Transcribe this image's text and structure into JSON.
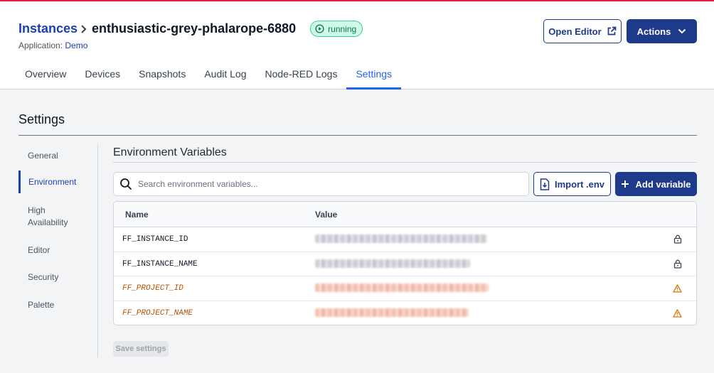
{
  "breadcrumb": {
    "parent": "Instances",
    "current": "enthusiastic-grey-phalarope-6880"
  },
  "status": "running",
  "application": {
    "label": "Application:",
    "name": "Demo"
  },
  "header_buttons": {
    "open_editor": "Open Editor",
    "actions": "Actions"
  },
  "tabs": [
    {
      "label": "Overview"
    },
    {
      "label": "Devices"
    },
    {
      "label": "Snapshots"
    },
    {
      "label": "Audit Log"
    },
    {
      "label": "Node-RED Logs"
    },
    {
      "label": "Settings",
      "active": true
    }
  ],
  "settings": {
    "title": "Settings",
    "sidebar": [
      {
        "label": "General"
      },
      {
        "label": "Environment",
        "active": true
      },
      {
        "label": "High Availability"
      },
      {
        "label": "Editor"
      },
      {
        "label": "Security"
      },
      {
        "label": "Palette"
      }
    ]
  },
  "env": {
    "section_title": "Environment Variables",
    "search_placeholder": "Search environment variables...",
    "import_label": "Import .env",
    "add_label": "Add variable",
    "columns": {
      "name": "Name",
      "value": "Value"
    },
    "rows": [
      {
        "name": "FF_INSTANCE_ID",
        "value": "7f3a9c1e-4b2d-4e8a-9c1f-2d3e4f5a6b7c",
        "icon": "lock-icon"
      },
      {
        "name": "FF_INSTANCE_NAME",
        "value": "enthusiastic-grey-phalarope-6880",
        "icon": "lock-icon"
      },
      {
        "name": "FF_PROJECT_ID",
        "value": "c1d2e3f4-a5b6-4c7d-8e9f-0a1b2c3d4e5f",
        "icon": "warning-icon"
      },
      {
        "name": "FF_PROJECT_NAME",
        "value": "enthusiastic-grey-phalarope-6880",
        "icon": "warning-icon"
      }
    ],
    "save_label": "Save settings"
  },
  "colors": {
    "primary": "#1e3a8a",
    "accent": "#2563eb",
    "running": "#047857",
    "warning": "#b45309"
  }
}
